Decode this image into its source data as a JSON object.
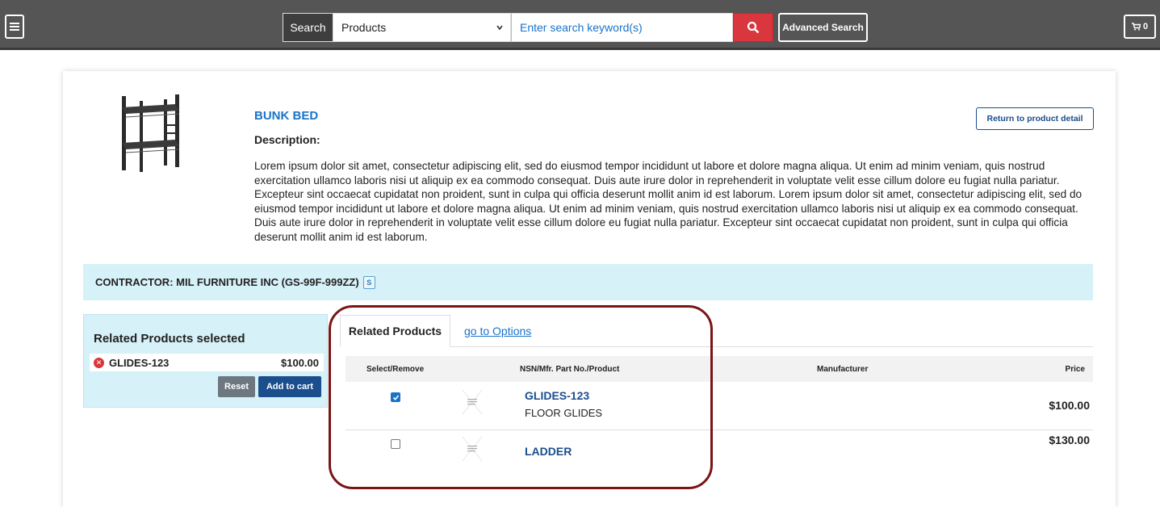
{
  "header": {
    "search_label": "Search",
    "search_category": "Products",
    "search_placeholder": "Enter search keyword(s)",
    "advanced_search_label": "Advanced Search",
    "cart_count": "0"
  },
  "product": {
    "title": "BUNK BED",
    "description_label": "Description:",
    "description": "Lorem ipsum dolor sit amet, consectetur adipiscing elit, sed do eiusmod tempor incididunt ut labore et dolore magna aliqua. Ut enim ad minim veniam, quis nostrud exercitation ullamco laboris nisi ut aliquip ex ea commodo consequat. Duis aute irure dolor in reprehenderit in voluptate velit esse cillum dolore eu fugiat nulla pariatur. Excepteur sint occaecat cupidatat non proident, sunt in culpa qui officia deserunt mollit anim id est laborum.  Lorem ipsum dolor sit amet, consectetur adipiscing elit, sed do eiusmod tempor incididunt ut labore et dolore magna aliqua. Ut enim ad minim veniam, quis nostrud exercitation ullamco laboris nisi ut aliquip ex ea commodo consequat. Duis aute irure dolor in reprehenderit in voluptate velit esse cillum dolore eu fugiat nulla pariatur. Excepteur sint occaecat cupidatat non proident, sunt in culpa qui officia deserunt mollit anim id est laborum.",
    "return_label": "Return to product detail"
  },
  "contractor": {
    "text": "CONTRACTOR: MIL FURNITURE INC (GS-99F-999ZZ)",
    "badge": "S"
  },
  "related_selected": {
    "title": "Related Products selected",
    "items": [
      {
        "part": "GLIDES-123",
        "price": "$100.00"
      }
    ],
    "reset_label": "Reset",
    "add_to_cart_label": "Add to cart"
  },
  "tabs": {
    "active": "Related Products",
    "link": "go to Options"
  },
  "table": {
    "headers": {
      "select": "Select/Remove",
      "product": "NSN/Mfr. Part No./Product",
      "manufacturer": "Manufacturer",
      "price": "Price"
    },
    "rows": [
      {
        "checked": true,
        "part": "GLIDES-123",
        "desc": "FLOOR GLIDES",
        "price": "$100.00"
      },
      {
        "checked": false,
        "part": "LADDER",
        "desc": "",
        "price": "$130.00"
      }
    ]
  },
  "colors": {
    "accent": "#1a73c8",
    "search_button": "#d9363e",
    "contractor_bg": "#d7f1f8",
    "highlight": "#7a1515"
  }
}
